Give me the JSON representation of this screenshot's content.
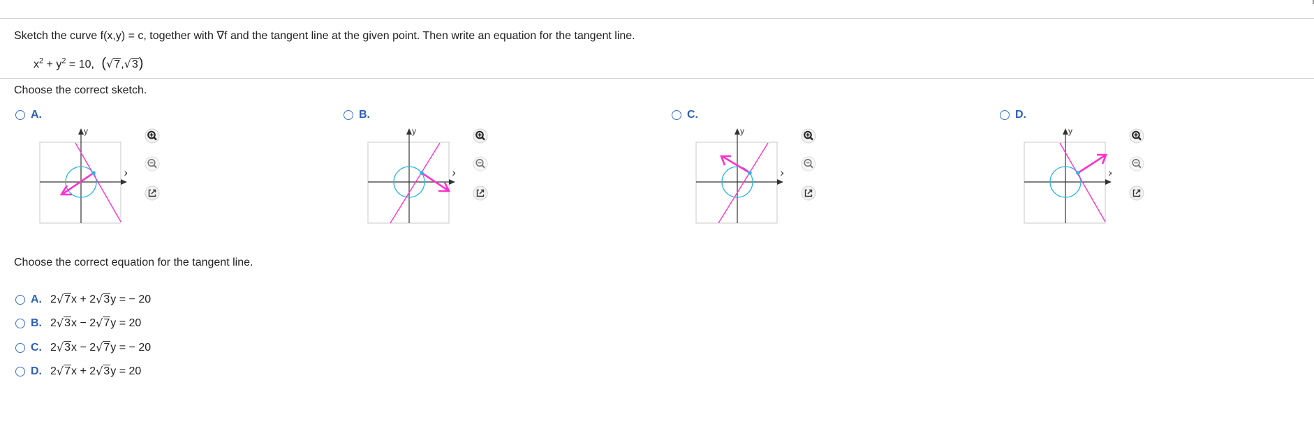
{
  "prompt": "Sketch the curve f(x,y) = c, together with ∇f and the tangent line at the given point. Then write an equation for the tangent line.",
  "equation": {
    "x_base": "x",
    "x_exp": "2",
    "plus": " + ",
    "y_base": "y",
    "y_exp": "2",
    "rhs": " = 10,",
    "point_open": "(",
    "radical": "√",
    "p1": "7",
    "sep": ",",
    "p2": "3",
    "point_close": ")"
  },
  "sketch_question": "Choose the correct sketch.",
  "sketch_options": [
    {
      "letter": "A.",
      "axis_x": "x",
      "axis_y": "y"
    },
    {
      "letter": "B.",
      "axis_x": "x",
      "axis_y": "y"
    },
    {
      "letter": "C.",
      "axis_x": "x",
      "axis_y": "y"
    },
    {
      "letter": "D.",
      "axis_x": "x",
      "axis_y": "y"
    }
  ],
  "colors": {
    "circle": "#29b6e6",
    "vector": "#ff33cc",
    "line": "#ff33cc",
    "radio": "#3a6fd0",
    "letter": "#2d5fb8"
  },
  "tools": [
    "zoom-in-icon",
    "zoom-out-icon",
    "popout-icon"
  ],
  "equation_question": "Choose the correct equation for the tangent line.",
  "equation_options": [
    {
      "letter": "A.",
      "c1": "2",
      "r1": "7",
      "v1": "x",
      "op": "+",
      "c2": "2",
      "r2": "3",
      "v2": "y",
      "eq": "=",
      "rhs": "− 20"
    },
    {
      "letter": "B.",
      "c1": "2",
      "r1": "3",
      "v1": "x",
      "op": "−",
      "c2": "2",
      "r2": "7",
      "v2": "y",
      "eq": "=",
      "rhs": "20"
    },
    {
      "letter": "C.",
      "c1": "2",
      "r1": "3",
      "v1": "x",
      "op": "−",
      "c2": "2",
      "r2": "7",
      "v2": "y",
      "eq": "=",
      "rhs": "− 20"
    },
    {
      "letter": "D.",
      "c1": "2",
      "r1": "7",
      "v1": "x",
      "op": "+",
      "c2": "2",
      "r2": "3",
      "v2": "y",
      "eq": "=",
      "rhs": "20"
    }
  ]
}
